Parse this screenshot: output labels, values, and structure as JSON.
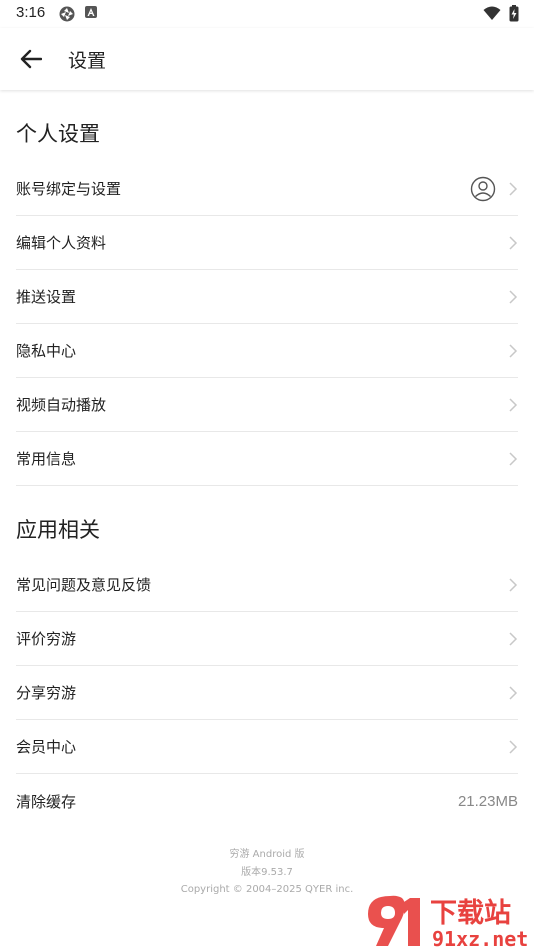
{
  "status_bar": {
    "time": "3:16"
  },
  "header": {
    "title": "设置"
  },
  "personal_section": {
    "title": "个人设置",
    "items": [
      {
        "label": "账号绑定与设置"
      },
      {
        "label": "编辑个人资料"
      },
      {
        "label": "推送设置"
      },
      {
        "label": "隐私中心"
      },
      {
        "label": "视频自动播放"
      },
      {
        "label": "常用信息"
      }
    ]
  },
  "app_section": {
    "title": "应用相关",
    "items": [
      {
        "label": "常见问题及意见反馈"
      },
      {
        "label": "评价穷游"
      },
      {
        "label": "分享穷游"
      },
      {
        "label": "会员中心"
      },
      {
        "label": "清除缓存",
        "value": "21.23MB"
      }
    ]
  },
  "footer": {
    "app_name": "穷游 Android 版",
    "version": "版本9.53.7",
    "copyright": "Copyright © 2004–2025 QYER inc."
  },
  "watermark": {
    "brand": "下载站",
    "domain": "91xz.net"
  },
  "colors": {
    "divider": "#e8e8e8",
    "text_primary": "#222222",
    "text_secondary": "#888888",
    "chevron": "#c8c8c8",
    "watermark_red": "#e8423f"
  }
}
